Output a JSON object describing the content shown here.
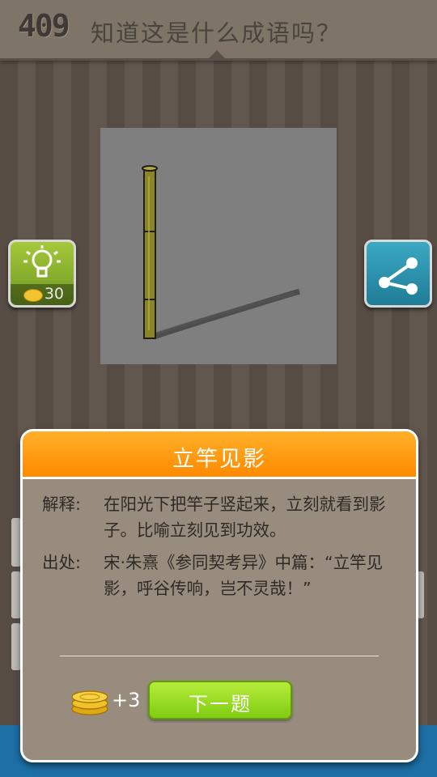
{
  "header": {
    "level": "409",
    "question": "知道这是什么成语吗？"
  },
  "hint": {
    "cost": "30",
    "icon": "lightbulb-icon"
  },
  "share": {
    "icon": "share-icon"
  },
  "dialog": {
    "title": "立竿见影",
    "explanation_label": "解释:",
    "explanation_text": "在阳光下把竿子竖起来，立刻就看到影子。比喻立刻见到功效。",
    "source_label": "出处:",
    "source_text": "宋·朱熹《参同契考异》中篇：“立竿见影，呼谷传响，岂不灵哉！”",
    "reward": "+3",
    "next_label": "下一题"
  },
  "colors": {
    "accent": "#ff9a10",
    "next_button": "#9cdc28",
    "hint_button": "#8db430",
    "share_button": "#2f98b4"
  }
}
